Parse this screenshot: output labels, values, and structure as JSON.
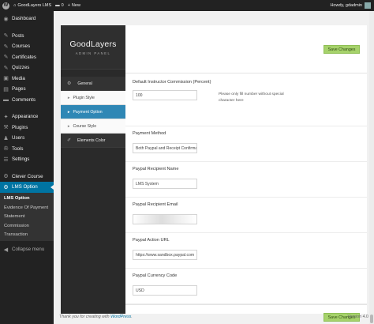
{
  "adminbar": {
    "site_name": "GoodLayers LMS",
    "comments_count": "0",
    "new_label": "New",
    "howdy": "Howdy, gdadmin"
  },
  "sidebar": {
    "items": [
      {
        "label": "Dashboard",
        "icon": "dashboard-icon",
        "glyph": "◉"
      },
      {
        "label": "Posts",
        "icon": "pin-icon",
        "glyph": "✎"
      },
      {
        "label": "Courses",
        "icon": "pin-icon",
        "glyph": "✎"
      },
      {
        "label": "Certificates",
        "icon": "pin-icon",
        "glyph": "✎"
      },
      {
        "label": "Quizzes",
        "icon": "pin-icon",
        "glyph": "✎"
      },
      {
        "label": "Media",
        "icon": "media-icon",
        "glyph": "▣"
      },
      {
        "label": "Pages",
        "icon": "pages-icon",
        "glyph": "▤"
      },
      {
        "label": "Comments",
        "icon": "comments-icon",
        "glyph": "▬"
      },
      {
        "label": "Appearance",
        "icon": "appearance-icon",
        "glyph": "✦"
      },
      {
        "label": "Plugins",
        "icon": "plugins-icon",
        "glyph": "⚒"
      },
      {
        "label": "Users",
        "icon": "users-icon",
        "glyph": "♟"
      },
      {
        "label": "Tools",
        "icon": "tools-icon",
        "glyph": "✇"
      },
      {
        "label": "Settings",
        "icon": "settings-icon",
        "glyph": "☰"
      },
      {
        "label": "Clever Course",
        "icon": "gear-icon",
        "glyph": "⚙"
      },
      {
        "label": "LMS Option",
        "icon": "gear-icon",
        "glyph": "⚙"
      }
    ],
    "submenu": [
      "LMS Option",
      "Evidence Of Payment",
      "Statement",
      "Commission",
      "Transaction"
    ],
    "collapse_label": "Collapse menu"
  },
  "panel": {
    "logo": "GoodLayers",
    "subtitle": "ADMIN PANEL",
    "menu": [
      {
        "label": "General",
        "type": "top",
        "icon": "gear-icon",
        "glyph": "⚙"
      },
      {
        "label": "Plugin Style",
        "type": "sub",
        "active": false
      },
      {
        "label": "Payment Option",
        "type": "sub",
        "active": true
      },
      {
        "label": "Course Style",
        "type": "sub",
        "active": false
      },
      {
        "label": "Elements Color",
        "type": "top",
        "icon": "brush-icon",
        "glyph": "✐"
      }
    ]
  },
  "save_label": "Save Changes",
  "fields": [
    {
      "label": "Default Instructor Commission (Percent)",
      "value": "100",
      "desc": "Please only fill number without special character here"
    },
    {
      "label": "Payment Method",
      "value": "Both Paypal and Receipt Confirmat"
    },
    {
      "label": "Paypal Recipient Name",
      "value": "LMS System"
    },
    {
      "label": "Paypal Recipient Email",
      "value": "(blurred)"
    },
    {
      "label": "Paypal Action URL",
      "value": "https://www.sandbox.paypal.com"
    },
    {
      "label": "Paypal Currency Code",
      "value": "USD"
    }
  ],
  "footer": {
    "credit_prefix": "Thank you for creating with ",
    "credit_link": "WordPress",
    "credit_suffix": ".",
    "version": "Version 4.0"
  }
}
